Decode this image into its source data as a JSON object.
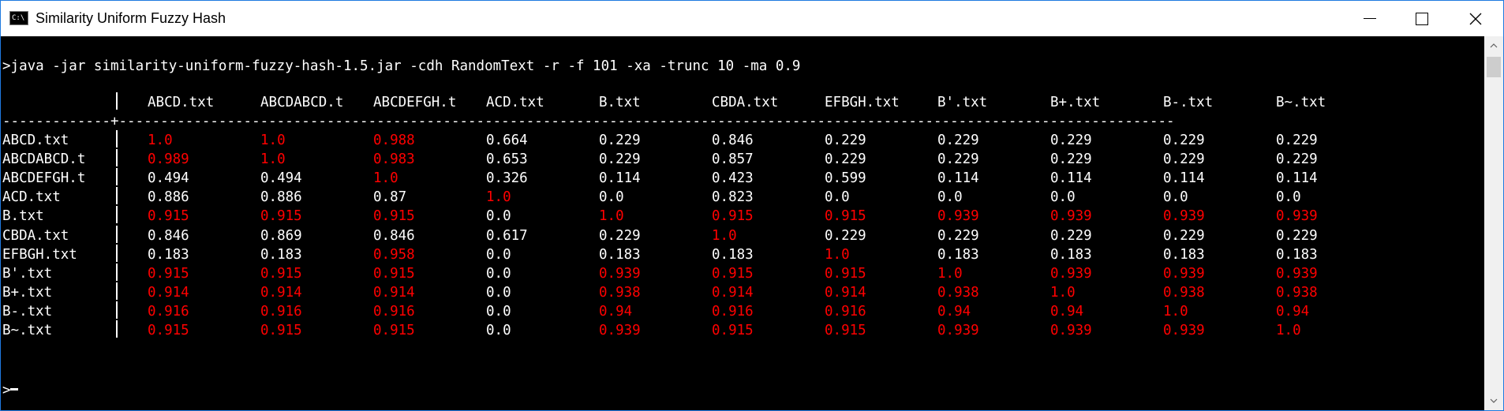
{
  "window": {
    "title": "Similarity Uniform Fuzzy Hash",
    "icon_label": "C:\\"
  },
  "console": {
    "command": ">java -jar similarity-uniform-fuzzy-hash-1.5.jar -cdh RandomText -r -f 101 -xa -trunc 10 -ma 0.9",
    "prompt": ">",
    "separator": "-------------+-------------------------------------------------------------------------------------------------------------------------------",
    "headers": [
      "ABCD.txt",
      "ABCDABCD.t",
      "ABCDEFGH.t",
      "ACD.txt",
      "B.txt",
      "CBDA.txt",
      "EFBGH.txt",
      "B'.txt",
      "B+.txt",
      "B-.txt",
      "B~.txt"
    ],
    "rows": [
      {
        "name": "ABCD.txt",
        "cells": [
          {
            "v": "1.0",
            "hi": true
          },
          {
            "v": "1.0",
            "hi": true
          },
          {
            "v": "0.988",
            "hi": true
          },
          {
            "v": "0.664",
            "hi": false
          },
          {
            "v": "0.229",
            "hi": false
          },
          {
            "v": "0.846",
            "hi": false
          },
          {
            "v": "0.229",
            "hi": false
          },
          {
            "v": "0.229",
            "hi": false
          },
          {
            "v": "0.229",
            "hi": false
          },
          {
            "v": "0.229",
            "hi": false
          },
          {
            "v": "0.229",
            "hi": false
          }
        ]
      },
      {
        "name": "ABCDABCD.t",
        "cells": [
          {
            "v": "0.989",
            "hi": true
          },
          {
            "v": "1.0",
            "hi": true
          },
          {
            "v": "0.983",
            "hi": true
          },
          {
            "v": "0.653",
            "hi": false
          },
          {
            "v": "0.229",
            "hi": false
          },
          {
            "v": "0.857",
            "hi": false
          },
          {
            "v": "0.229",
            "hi": false
          },
          {
            "v": "0.229",
            "hi": false
          },
          {
            "v": "0.229",
            "hi": false
          },
          {
            "v": "0.229",
            "hi": false
          },
          {
            "v": "0.229",
            "hi": false
          }
        ]
      },
      {
        "name": "ABCDEFGH.t",
        "cells": [
          {
            "v": "0.494",
            "hi": false
          },
          {
            "v": "0.494",
            "hi": false
          },
          {
            "v": "1.0",
            "hi": true
          },
          {
            "v": "0.326",
            "hi": false
          },
          {
            "v": "0.114",
            "hi": false
          },
          {
            "v": "0.423",
            "hi": false
          },
          {
            "v": "0.599",
            "hi": false
          },
          {
            "v": "0.114",
            "hi": false
          },
          {
            "v": "0.114",
            "hi": false
          },
          {
            "v": "0.114",
            "hi": false
          },
          {
            "v": "0.114",
            "hi": false
          }
        ]
      },
      {
        "name": "ACD.txt",
        "cells": [
          {
            "v": "0.886",
            "hi": false
          },
          {
            "v": "0.886",
            "hi": false
          },
          {
            "v": "0.87",
            "hi": false
          },
          {
            "v": "1.0",
            "hi": true
          },
          {
            "v": "0.0",
            "hi": false
          },
          {
            "v": "0.823",
            "hi": false
          },
          {
            "v": "0.0",
            "hi": false
          },
          {
            "v": "0.0",
            "hi": false
          },
          {
            "v": "0.0",
            "hi": false
          },
          {
            "v": "0.0",
            "hi": false
          },
          {
            "v": "0.0",
            "hi": false
          }
        ]
      },
      {
        "name": "B.txt",
        "cells": [
          {
            "v": "0.915",
            "hi": true
          },
          {
            "v": "0.915",
            "hi": true
          },
          {
            "v": "0.915",
            "hi": true
          },
          {
            "v": "0.0",
            "hi": false
          },
          {
            "v": "1.0",
            "hi": true
          },
          {
            "v": "0.915",
            "hi": true
          },
          {
            "v": "0.915",
            "hi": true
          },
          {
            "v": "0.939",
            "hi": true
          },
          {
            "v": "0.939",
            "hi": true
          },
          {
            "v": "0.939",
            "hi": true
          },
          {
            "v": "0.939",
            "hi": true
          }
        ]
      },
      {
        "name": "CBDA.txt",
        "cells": [
          {
            "v": "0.846",
            "hi": false
          },
          {
            "v": "0.869",
            "hi": false
          },
          {
            "v": "0.846",
            "hi": false
          },
          {
            "v": "0.617",
            "hi": false
          },
          {
            "v": "0.229",
            "hi": false
          },
          {
            "v": "1.0",
            "hi": true
          },
          {
            "v": "0.229",
            "hi": false
          },
          {
            "v": "0.229",
            "hi": false
          },
          {
            "v": "0.229",
            "hi": false
          },
          {
            "v": "0.229",
            "hi": false
          },
          {
            "v": "0.229",
            "hi": false
          }
        ]
      },
      {
        "name": "EFBGH.txt",
        "cells": [
          {
            "v": "0.183",
            "hi": false
          },
          {
            "v": "0.183",
            "hi": false
          },
          {
            "v": "0.958",
            "hi": true
          },
          {
            "v": "0.0",
            "hi": false
          },
          {
            "v": "0.183",
            "hi": false
          },
          {
            "v": "0.183",
            "hi": false
          },
          {
            "v": "1.0",
            "hi": true
          },
          {
            "v": "0.183",
            "hi": false
          },
          {
            "v": "0.183",
            "hi": false
          },
          {
            "v": "0.183",
            "hi": false
          },
          {
            "v": "0.183",
            "hi": false
          }
        ]
      },
      {
        "name": "B'.txt",
        "cells": [
          {
            "v": "0.915",
            "hi": true
          },
          {
            "v": "0.915",
            "hi": true
          },
          {
            "v": "0.915",
            "hi": true
          },
          {
            "v": "0.0",
            "hi": false
          },
          {
            "v": "0.939",
            "hi": true
          },
          {
            "v": "0.915",
            "hi": true
          },
          {
            "v": "0.915",
            "hi": true
          },
          {
            "v": "1.0",
            "hi": true
          },
          {
            "v": "0.939",
            "hi": true
          },
          {
            "v": "0.939",
            "hi": true
          },
          {
            "v": "0.939",
            "hi": true
          }
        ]
      },
      {
        "name": "B+.txt",
        "cells": [
          {
            "v": "0.914",
            "hi": true
          },
          {
            "v": "0.914",
            "hi": true
          },
          {
            "v": "0.914",
            "hi": true
          },
          {
            "v": "0.0",
            "hi": false
          },
          {
            "v": "0.938",
            "hi": true
          },
          {
            "v": "0.914",
            "hi": true
          },
          {
            "v": "0.914",
            "hi": true
          },
          {
            "v": "0.938",
            "hi": true
          },
          {
            "v": "1.0",
            "hi": true
          },
          {
            "v": "0.938",
            "hi": true
          },
          {
            "v": "0.938",
            "hi": true
          }
        ]
      },
      {
        "name": "B-.txt",
        "cells": [
          {
            "v": "0.916",
            "hi": true
          },
          {
            "v": "0.916",
            "hi": true
          },
          {
            "v": "0.916",
            "hi": true
          },
          {
            "v": "0.0",
            "hi": false
          },
          {
            "v": "0.94",
            "hi": true
          },
          {
            "v": "0.916",
            "hi": true
          },
          {
            "v": "0.916",
            "hi": true
          },
          {
            "v": "0.94",
            "hi": true
          },
          {
            "v": "0.94",
            "hi": true
          },
          {
            "v": "1.0",
            "hi": true
          },
          {
            "v": "0.94",
            "hi": true
          }
        ]
      },
      {
        "name": "B~.txt",
        "cells": [
          {
            "v": "0.915",
            "hi": true
          },
          {
            "v": "0.915",
            "hi": true
          },
          {
            "v": "0.915",
            "hi": true
          },
          {
            "v": "0.0",
            "hi": false
          },
          {
            "v": "0.939",
            "hi": true
          },
          {
            "v": "0.915",
            "hi": true
          },
          {
            "v": "0.915",
            "hi": true
          },
          {
            "v": "0.939",
            "hi": true
          },
          {
            "v": "0.939",
            "hi": true
          },
          {
            "v": "0.939",
            "hi": true
          },
          {
            "v": "1.0",
            "hi": true
          }
        ]
      }
    ]
  },
  "colors": {
    "background": "#000000",
    "text": "#ffffff",
    "highlight": "#ff0000"
  }
}
